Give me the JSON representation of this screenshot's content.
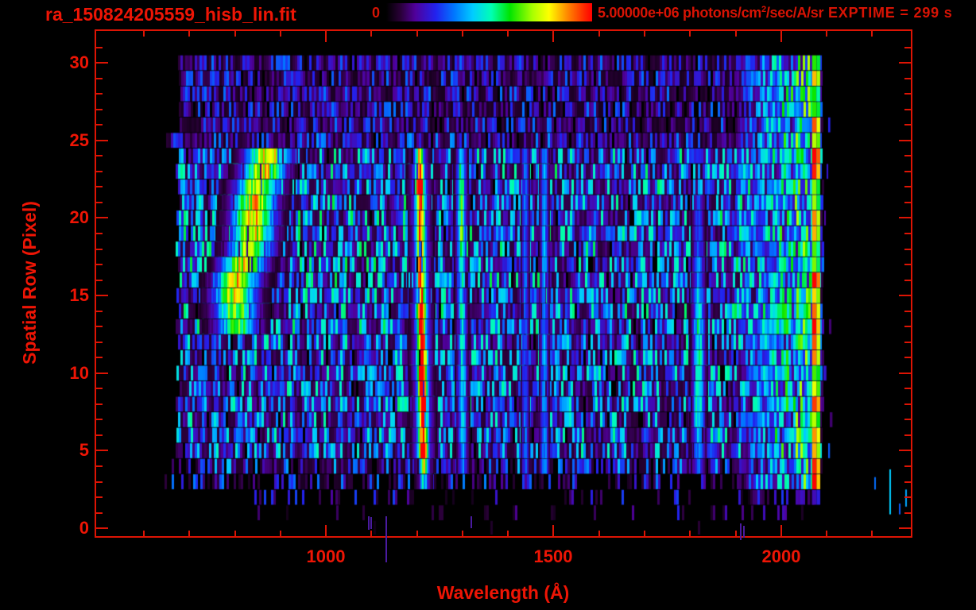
{
  "page": {
    "background": "#000000",
    "accent_red": "#ee1505",
    "dim_red": "#d81304",
    "frame_red": "#dd1404"
  },
  "header": {
    "title": "ra_150824205559_hisb_lin.fit",
    "colorbar": {
      "min_label": "0",
      "max_label_value": "5.00000e+06",
      "max_label_unit_main": " photons/cm",
      "max_label_unit_sup": "2",
      "max_label_unit_tail": "/sec/A/sr"
    },
    "exptime_label": "EXPTIME = 299 s"
  },
  "chart_data": {
    "type": "heatmap",
    "title": "ra_150824205559_hisb_lin.fit",
    "xlabel": "Wavelength (Å)",
    "ylabel": "Spatial Row (Pixel)",
    "xlim": [
      495,
      2285
    ],
    "ylim": [
      -0.4,
      32.05
    ],
    "x_major_ticks": [
      1000,
      1500,
      2000
    ],
    "x_tick_labels": [
      "1000",
      "1500",
      "2000"
    ],
    "x_minor_start": 600,
    "x_minor_end": 2200,
    "x_minor_step": 100,
    "y_major_ticks": [
      0,
      5,
      10,
      15,
      20,
      25,
      30
    ],
    "y_tick_labels": [
      "0",
      "5",
      "10",
      "15",
      "20",
      "25",
      "30"
    ],
    "y_minor_step": 1,
    "colorbar_min": 0,
    "colorbar_max": 5000000,
    "colorbar_units": "photons/cm2/sec/A/sr",
    "exposure_s": 299,
    "colormap_stops": [
      [
        0.0,
        "#000000"
      ],
      [
        0.07,
        "#2a0038"
      ],
      [
        0.14,
        "#50009a"
      ],
      [
        0.24,
        "#2222ee"
      ],
      [
        0.33,
        "#0077ff"
      ],
      [
        0.42,
        "#00ccff"
      ],
      [
        0.51,
        "#00ffb4"
      ],
      [
        0.6,
        "#00e400"
      ],
      [
        0.71,
        "#a8ff00"
      ],
      [
        0.79,
        "#ffff00"
      ],
      [
        0.88,
        "#ff8800"
      ],
      [
        0.96,
        "#ff2a00"
      ],
      [
        1.0,
        "#ff0000"
      ]
    ],
    "seed": 1337,
    "rows": {
      "start_wl": [
        900,
        850,
        800,
        645,
        656,
        670,
        672,
        675,
        670,
        678,
        672,
        680,
        674,
        670,
        676,
        672,
        678,
        674,
        670,
        676,
        672,
        678,
        674,
        670,
        676,
        648,
        678,
        676,
        680,
        677,
        675
      ],
      "end_wl": [
        2060,
        2080,
        2086,
        2088,
        2089,
        2089,
        2090,
        2089,
        2090,
        2089,
        2090,
        2090,
        2089,
        2090,
        2089,
        2090,
        2089,
        2090,
        2090,
        2089,
        2090,
        2089,
        2090,
        2089,
        2090,
        2088,
        2089,
        2090,
        2089,
        2088,
        2086
      ],
      "density": [
        0.02,
        0.07,
        0.18,
        0.42,
        0.78,
        0.95,
        0.96,
        0.96,
        0.97,
        0.96,
        0.97,
        0.96,
        0.97,
        0.97,
        0.96,
        0.97,
        0.97,
        0.96,
        0.97,
        0.97,
        0.96,
        0.97,
        0.96,
        0.97,
        0.96,
        0.94,
        0.93,
        0.93,
        0.94,
        0.93,
        0.93
      ],
      "brightness": [
        0.1,
        0.12,
        0.14,
        0.17,
        0.21,
        0.25,
        0.26,
        0.26,
        0.27,
        0.26,
        0.27,
        0.27,
        0.27,
        0.28,
        0.28,
        0.28,
        0.28,
        0.28,
        0.28,
        0.28,
        0.28,
        0.28,
        0.28,
        0.28,
        0.27,
        0.18,
        0.16,
        0.16,
        0.16,
        0.16,
        0.16
      ]
    },
    "features": [
      {
        "type": "stripe",
        "name": "lyman-alpha-1216",
        "wl": 1213,
        "tilt": -0.45,
        "width": 8,
        "halo": 22,
        "halo_frac": 0.38,
        "rows": [
          3,
          24
        ],
        "intensities": [
          0.32,
          0.55,
          0.88,
          0.85,
          0.88,
          0.9,
          0.85,
          0.92,
          0.95,
          0.83,
          0.8,
          0.88,
          0.72,
          0.75,
          0.78,
          0.83,
          0.8,
          0.76,
          0.85,
          0.88,
          0.72,
          0.58
        ]
      },
      {
        "type": "stripe",
        "name": "oi-1304",
        "wl": 1299,
        "tilt": -0.2,
        "width": 9,
        "halo": 16,
        "halo_frac": 0.25,
        "rows": [
          4,
          24
        ],
        "intensities": [
          0.26,
          0.3,
          0.34,
          0.34,
          0.36,
          0.34,
          0.36,
          0.34,
          0.36,
          0.36,
          0.38,
          0.36,
          0.38,
          0.4,
          0.44,
          0.48,
          0.5,
          0.48,
          0.46,
          0.42,
          0.36
        ]
      },
      {
        "type": "stripe",
        "name": "line-1435",
        "wl": 1436,
        "width": 8,
        "rows": [
          4,
          24
        ],
        "intensity": 0.3
      },
      {
        "type": "stripe",
        "name": "line-1478",
        "wl": 1478,
        "width": 9,
        "rows": [
          4,
          24
        ],
        "intensity": 0.35
      },
      {
        "type": "stripe",
        "name": "line-1817",
        "wl": 1817,
        "width": 13,
        "rows": [
          4,
          21
        ],
        "intensities": [
          0.3,
          0.34,
          0.42,
          0.46,
          0.5,
          0.5,
          0.48,
          0.5,
          0.46,
          0.48,
          0.44,
          0.4,
          0.36,
          0.34,
          0.3,
          0.28,
          0.26,
          0.24
        ]
      },
      {
        "type": "blob",
        "name": "airglow-blob-800-880",
        "rows": [
          13,
          24
        ],
        "width": 40,
        "halo": 62,
        "halo_frac": 0.3,
        "centers": [
          804,
          799,
          797,
          803,
          817,
          832,
          836,
          838,
          841,
          849,
          861,
          871
        ],
        "intensities": [
          0.45,
          0.52,
          0.56,
          0.6,
          0.6,
          0.56,
          0.6,
          0.62,
          0.6,
          0.58,
          0.6,
          0.62
        ]
      }
    ],
    "right_band": {
      "wl_start": 1900,
      "wl_full": 1995,
      "wl_end": 2068,
      "intensity": 0.5,
      "row_min": 3
    },
    "edge_spike": {
      "wl_start": 2068,
      "wl_end": 2086,
      "row_min": 1
    },
    "outliers_beyond_edge": {
      "wl_min": 2092,
      "wl_max": 2115,
      "probability": 0.3,
      "intensity": 0.25
    },
    "hot_pixels": [
      {
        "wl": 2205,
        "row_from": 3.3,
        "row_to": 2.5,
        "v": 0.32
      },
      {
        "wl": 2238,
        "row_from": 3.8,
        "row_to": 0.9,
        "v": 0.42
      },
      {
        "wl": 2258,
        "row_from": 1.6,
        "row_to": 0.9,
        "v": 0.3
      },
      {
        "wl": 2272,
        "row_from": 2.5,
        "row_to": 1.4,
        "v": 0.38
      }
    ],
    "stray_columns": [
      {
        "wl": 1092,
        "row_from": 0.78,
        "row_to": -0.08
      },
      {
        "wl": 1097,
        "row_from": 0.73,
        "row_to": -0.05
      },
      {
        "wl": 1130,
        "row_from": 0.78,
        "row_to": -2.2
      },
      {
        "wl": 1318,
        "row_from": 0.78,
        "row_to": 0.02
      },
      {
        "wl": 1910,
        "row_from": 0.3,
        "row_to": -0.75
      },
      {
        "wl": 1917,
        "row_from": 0.15,
        "row_to": -0.6
      }
    ]
  }
}
